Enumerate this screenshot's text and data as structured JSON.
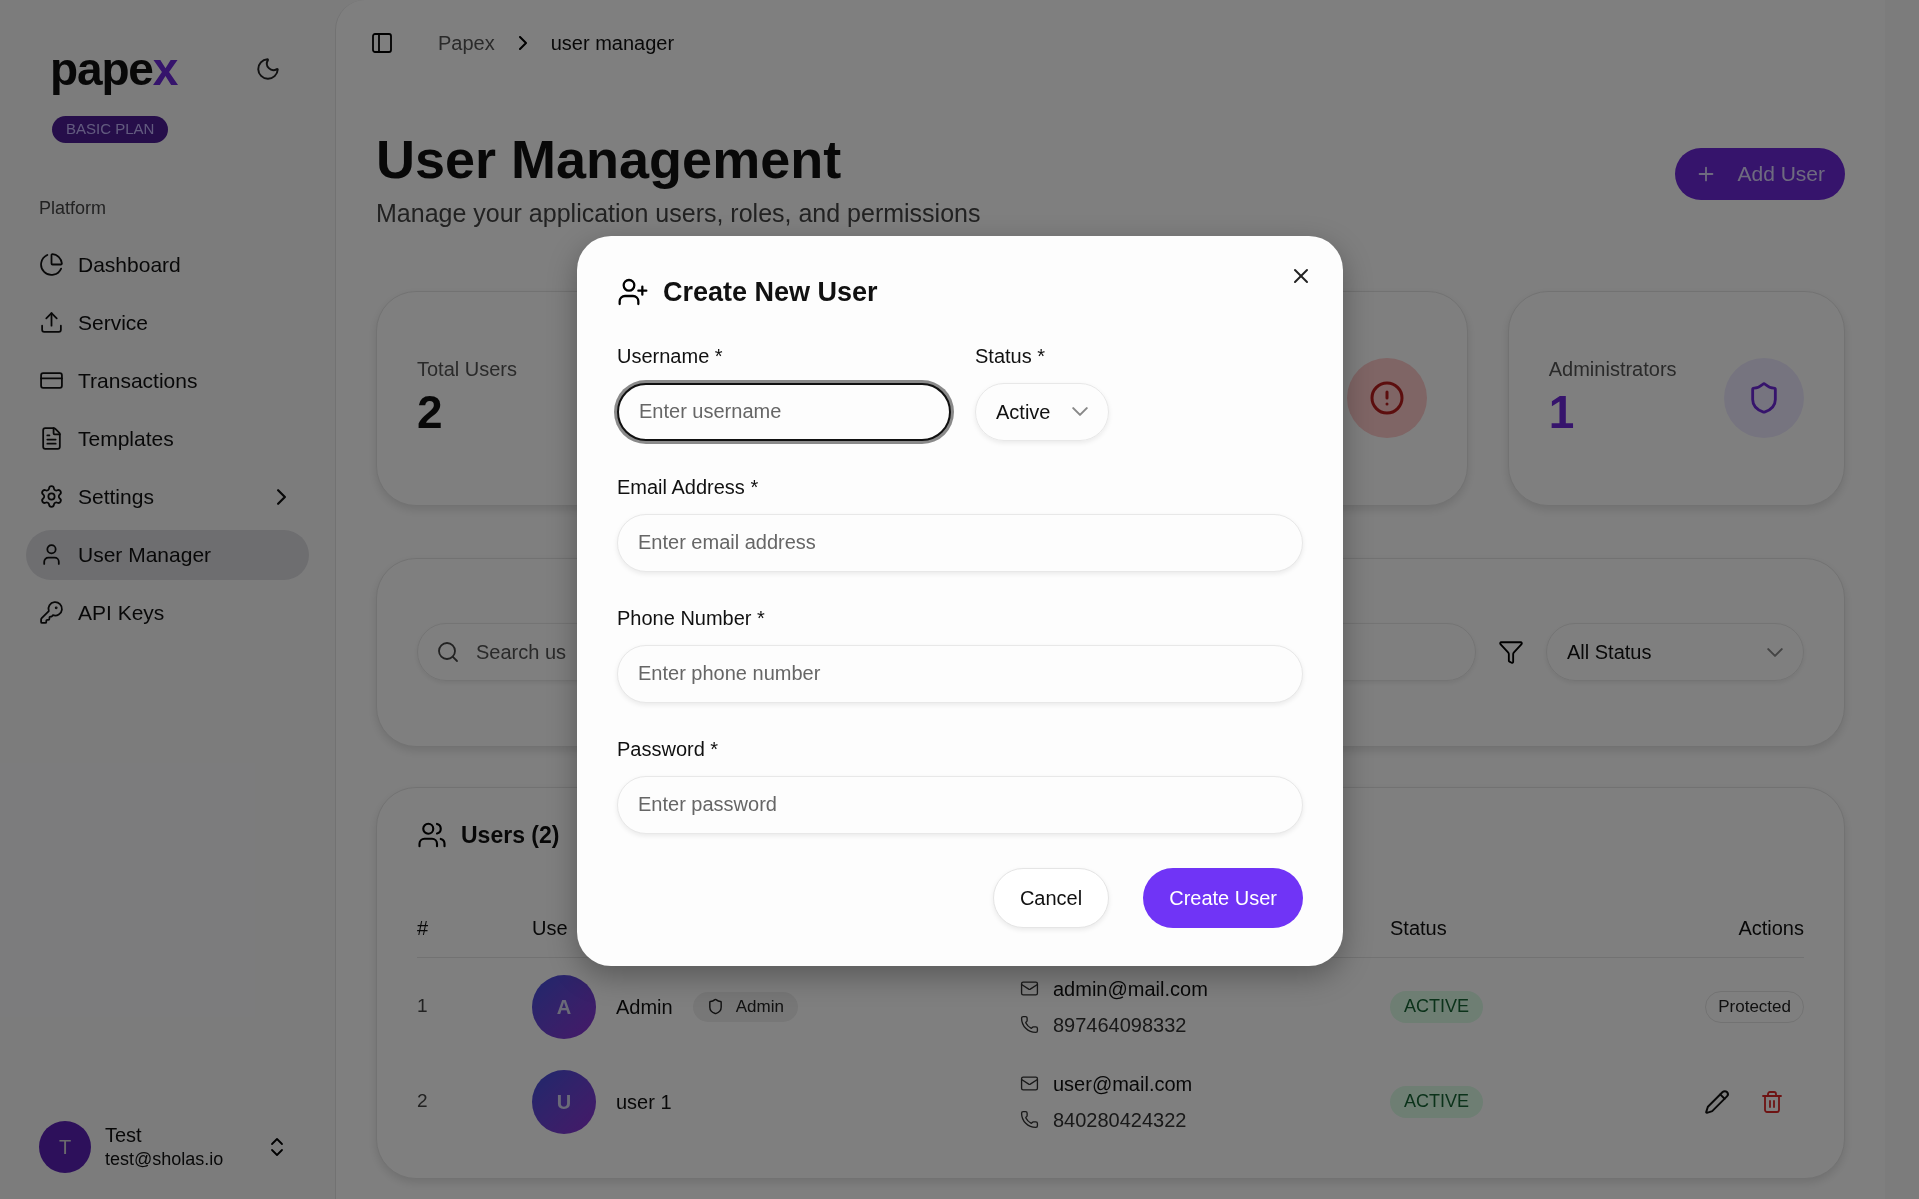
{
  "sidebar": {
    "logo": {
      "text": "pape",
      "mark": "x"
    },
    "plan_badge": "BASIC PLAN",
    "section_label": "Platform",
    "items": [
      {
        "label": "Dashboard",
        "selected": false,
        "has_submenu": false
      },
      {
        "label": "Service",
        "selected": false,
        "has_submenu": false
      },
      {
        "label": "Transactions",
        "selected": false,
        "has_submenu": false
      },
      {
        "label": "Templates",
        "selected": false,
        "has_submenu": false
      },
      {
        "label": "Settings",
        "selected": false,
        "has_submenu": true
      },
      {
        "label": "User Manager",
        "selected": true,
        "has_submenu": false
      },
      {
        "label": "API Keys",
        "selected": false,
        "has_submenu": false
      }
    ],
    "user": {
      "avatar_letter": "T",
      "name": "Test",
      "email": "test@sholas.io"
    }
  },
  "breadcrumb": [
    "Papex",
    "user manager"
  ],
  "header": {
    "title": "User Management",
    "subtitle": "Manage your application users, roles, and permissions",
    "add_button": "Add User"
  },
  "stat_cards": [
    {
      "kind": "plain",
      "label": "Total Users",
      "value": "2"
    },
    {
      "kind": "alert"
    },
    {
      "kind": "admin",
      "label": "Administrators",
      "value": "1"
    }
  ],
  "filters": {
    "search_placeholder": "Search us",
    "status_filter": "All Status"
  },
  "users_table": {
    "title": "Users (2)",
    "columns": [
      "#",
      "Use",
      "Status",
      "Actions"
    ],
    "rows": [
      {
        "number": "1",
        "avatar_letter": "A",
        "name": "Admin",
        "role_badge": "Admin",
        "email": "admin@mail.com",
        "phone": "897464098332",
        "status": {
          "text": "ACTIVE",
          "kind": "active"
        },
        "actions": {
          "kind": "protected",
          "label": "Protected"
        }
      },
      {
        "number": "2",
        "avatar_letter": "U",
        "name": "user 1",
        "email": "user@mail.com",
        "phone": "840280424322",
        "status": {
          "text": "ACTIVE",
          "kind": "active"
        },
        "actions": {
          "kind": "edit_delete"
        }
      }
    ]
  },
  "modal": {
    "title": "Create New User",
    "rows": [
      [
        {
          "kind": "text",
          "label": "Username *",
          "placeholder": "Enter username",
          "focused": true
        },
        {
          "kind": "select",
          "label": "Status *",
          "value": "Active"
        }
      ],
      [
        {
          "kind": "text",
          "label": "Email Address *",
          "placeholder": "Enter email address",
          "focused": false
        }
      ],
      [
        {
          "kind": "text",
          "label": "Phone Number *",
          "placeholder": "Enter phone number",
          "focused": false
        }
      ],
      [
        {
          "kind": "text",
          "label": "Password *",
          "placeholder": "Enter password",
          "focused": false
        }
      ]
    ],
    "cancel_button": "Cancel",
    "submit_button": "Create User"
  }
}
